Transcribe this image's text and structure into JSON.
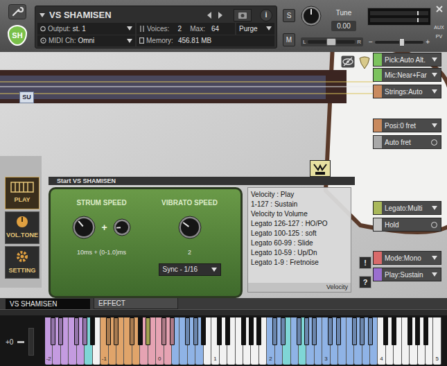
{
  "header": {
    "title": "VS SHAMISEN",
    "output_label": "Output:",
    "output": "st. 1",
    "voices_label": "Voices:",
    "voices": "2",
    "max_label": "Max:",
    "max": "64",
    "purge": "Purge",
    "midi_label": "MIDI Ch:",
    "midi": "Omni",
    "memory_label": "Memory:",
    "memory": "456.81 MB",
    "info": "i",
    "logo": "SH",
    "solo": "S",
    "mute": "M",
    "tune_label": "Tune",
    "tune": "0.00",
    "tune_level": 0.5,
    "pan_left": "L",
    "pan_right": "R",
    "pan_level": 0.5,
    "meters": [
      {
        "level": 0.0
      },
      {
        "level": 0.0
      }
    ],
    "volume_minus": "−",
    "volume_plus": "+",
    "volume_level": 0.55,
    "aux": "AUX",
    "pv": "PV"
  },
  "su_badge": "SU",
  "left_tabs": [
    {
      "label": "PLAY",
      "selected": true
    },
    {
      "label": "VOL.TONE",
      "selected": false
    },
    {
      "label": "SETTING",
      "selected": false
    }
  ],
  "start_bar": "Start VS SHAMISEN",
  "pedal": {
    "strum_label": "STRUM SPEED",
    "vibrato_label": "VIBRATO SPEED",
    "plus": "+",
    "strum_level": 0.35,
    "strum_fine_level": 0.15,
    "vibrato_level": 0.3,
    "strum_reading": "10ms + (0-1.0)ms",
    "vibrato_reading": "2",
    "sync": "Sync - 1/16"
  },
  "info": {
    "lines": [
      "Velocity : Play",
      "1-127 : Sustain",
      "Velocity to Volume",
      "Legato 126-127 : HO/PO",
      "Legato 100-125 : soft",
      "Legato 60-99 : Slide",
      "Legato 10-59 : Up/Dn",
      "Legato 1-9 : Fretnoise"
    ],
    "footer": "Velocity"
  },
  "help_buttons": [
    "!",
    "?"
  ],
  "right_controls": [
    {
      "label": "Pick:Auto Alt.",
      "kind": "dropdown",
      "color": "#7cc35e"
    },
    {
      "label": "Mic:Near+Far",
      "kind": "dropdown",
      "color": "#7cc35e"
    },
    {
      "label": "Strings:Auto",
      "kind": "dropdown",
      "color": "#c98a5e"
    },
    {
      "label": "Posi:0 fret",
      "kind": "dropdown",
      "color": "#c98a5e"
    },
    {
      "label": "Auto fret",
      "kind": "toggle",
      "on": false,
      "color": "#a8a8a8"
    },
    {
      "label": "Legato:Multi",
      "kind": "dropdown",
      "color": "#a9b85a"
    },
    {
      "label": "Hold",
      "kind": "toggle",
      "on": false,
      "color": "#c4c4c4"
    },
    {
      "label": "Mode:Mono",
      "kind": "dropdown",
      "color": "#d96a6a"
    },
    {
      "label": "Play:Sustain",
      "kind": "dropdown",
      "color": "#9a6fcf"
    }
  ],
  "bottom_tabs": [
    {
      "label": "VS SHAMISEN",
      "selected": true
    },
    {
      "label": "EFFECT",
      "selected": false
    }
  ],
  "keyboard": {
    "transpose": "+0",
    "octave_labels": [
      "-2",
      "-1",
      "0",
      "1",
      "2",
      "3",
      "4",
      "5"
    ],
    "zones": [
      {
        "from": 0,
        "to": 8,
        "color": "#c49be0"
      },
      {
        "from": 9,
        "to": 9,
        "color": "#7fd6d6"
      },
      {
        "from": 12,
        "to": 19,
        "color": "#e0a46a"
      },
      {
        "from": 21,
        "to": 27,
        "color": "#e6a3b3"
      },
      {
        "from": 22,
        "to": 22,
        "color": "#d6d66a"
      },
      {
        "from": 28,
        "to": 33,
        "color": "#8fb3e6"
      },
      {
        "from": 48,
        "to": 71,
        "color": "#8fb3e6"
      },
      {
        "from": 52,
        "to": 52,
        "color": "#7fd6d6"
      },
      {
        "from": 55,
        "to": 55,
        "color": "#7fd6d6"
      }
    ]
  }
}
